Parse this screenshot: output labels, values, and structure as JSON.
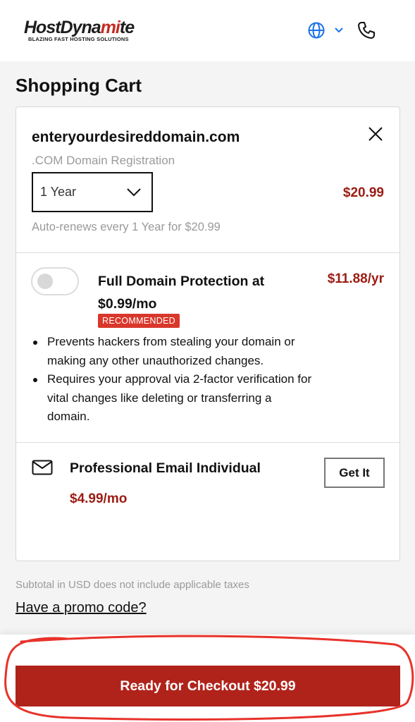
{
  "header": {
    "logo_text_a": "HostDyna",
    "logo_text_b": "mi",
    "logo_text_c": "te",
    "logo_tagline": "BLAZING FAST HOSTING SOLUTIONS",
    "language_icon": "globe-icon",
    "phone_icon": "phone-icon"
  },
  "page": {
    "title": "Shopping Cart"
  },
  "domain_item": {
    "name": "enteryourdesireddomain.com",
    "subtitle": ".COM Domain Registration",
    "term_selected": "1 Year",
    "price": "$20.99",
    "autorenew": "Auto-renews every 1 Year for $20.99",
    "remove_icon": "close-icon"
  },
  "protection": {
    "title": "Full Domain Protection at $0.99/mo",
    "price": "$11.88/yr",
    "badge": "RECOMMENDED",
    "enabled": false,
    "bullets": [
      "Prevents hackers from stealing your domain or making any other unauthorized changes.",
      "Requires your approval via 2-factor verification for vital changes like deleting or transferring a domain."
    ]
  },
  "email": {
    "title": "Professional Email Individual",
    "price": "$4.99/mo",
    "button": "Get It",
    "icon": "mail-icon"
  },
  "summary": {
    "tax_note": "Subtotal in USD does not include applicable taxes",
    "promo_link": "Have a promo code?"
  },
  "checkout": {
    "button": "Ready for Checkout $20.99"
  },
  "colors": {
    "accent_red": "#b0231b",
    "price_red": "#9b1c13",
    "badge_red": "#d9372b",
    "annotation_red": "#e8322a",
    "link_blue": "#1a73e8"
  }
}
